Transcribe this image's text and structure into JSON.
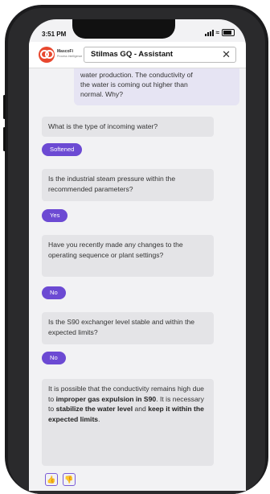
{
  "status": {
    "time": "3:51 PM"
  },
  "header": {
    "brand_name": "MascoFi",
    "brand_tagline": "Process Intelligence",
    "title": "Stilmas GQ - Assistant",
    "close_glyph": "✕"
  },
  "user_message": {
    "lines": [
      "water production. The conductivity of",
      "the water is coming out higher than",
      "normal. Why?"
    ]
  },
  "conversation": [
    {
      "question": "What is the type of incoming water?",
      "answer": "Softened"
    },
    {
      "question": "Is the industrial steam pressure within the recommended parameters?",
      "answer": "Yes"
    },
    {
      "question": "Have you recently made any changes to the operating sequence or plant settings?",
      "answer": "No"
    },
    {
      "question": "Is the S90 exchanger level stable and within the expected limits?",
      "answer": "No"
    }
  ],
  "final_answer": {
    "p1": "It is possible that the conductivity remains high due to ",
    "b1": "improper gas expulsion in S90",
    "p2": ". It is necessary to ",
    "b2": "stabilize the water level",
    "p3": " and ",
    "b3": "keep it within the expected limits",
    "p4": "."
  },
  "feedback": {
    "up_icon": "thumbs-up-icon",
    "down_icon": "thumbs-down-icon"
  },
  "colors": {
    "accent": "#6c4ad3",
    "logo": "#e8472e",
    "bubble": "#e4e4e7",
    "user_bubble": "#e6e4f3"
  }
}
